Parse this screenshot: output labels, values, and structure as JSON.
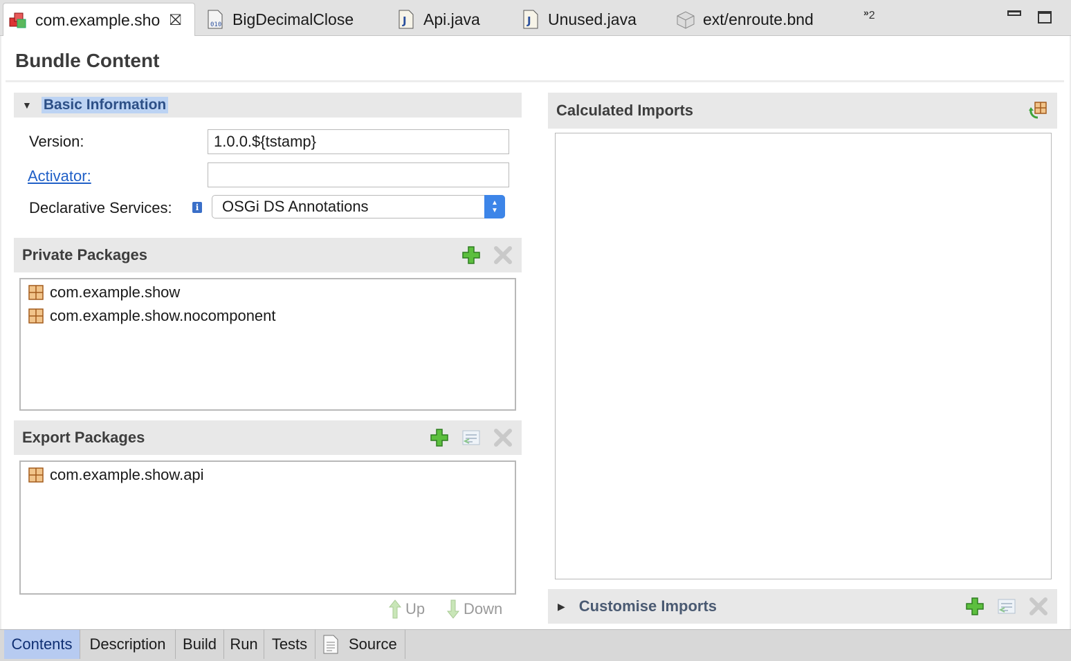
{
  "editor_tabs": [
    {
      "label": "com.example.sho",
      "icon": "bundle-icon",
      "active": true
    },
    {
      "label": "BigDecimalClose",
      "icon": "class-file-icon",
      "active": false
    },
    {
      "label": "Api.java",
      "icon": "java-file-icon",
      "active": false
    },
    {
      "label": "Unused.java",
      "icon": "java-file-icon",
      "active": false
    },
    {
      "label": "ext/enroute.bnd",
      "icon": "bnd-file-icon",
      "active": false
    }
  ],
  "hidden_tabs": {
    "chevron": "»",
    "count": "2"
  },
  "page_title": "Bundle Content",
  "basic_info": {
    "title": "Basic Information",
    "version_label": "Version:",
    "version_value": "1.0.0.${tstamp}",
    "activator_label": "Activator:",
    "activator_value": "",
    "ds_label": "Declarative Services:",
    "ds_value": "OSGi DS Annotations"
  },
  "private_packages": {
    "title": "Private Packages",
    "items": [
      "com.example.show",
      "com.example.show.nocomponent"
    ]
  },
  "export_packages": {
    "title": "Export Packages",
    "items": [
      "com.example.show.api"
    ],
    "up_label": "Up",
    "down_label": "Down"
  },
  "calculated_imports": {
    "title": "Calculated Imports"
  },
  "customise_imports": {
    "title": "Customise Imports"
  },
  "page_tabs": [
    "Contents",
    "Description",
    "Build",
    "Run",
    "Tests",
    "Source"
  ],
  "colors": {
    "accent": "#3d85e8",
    "link": "#1f5fc7",
    "active_page_tab": "#b7cbf1",
    "add_green": "#3fa33a"
  }
}
